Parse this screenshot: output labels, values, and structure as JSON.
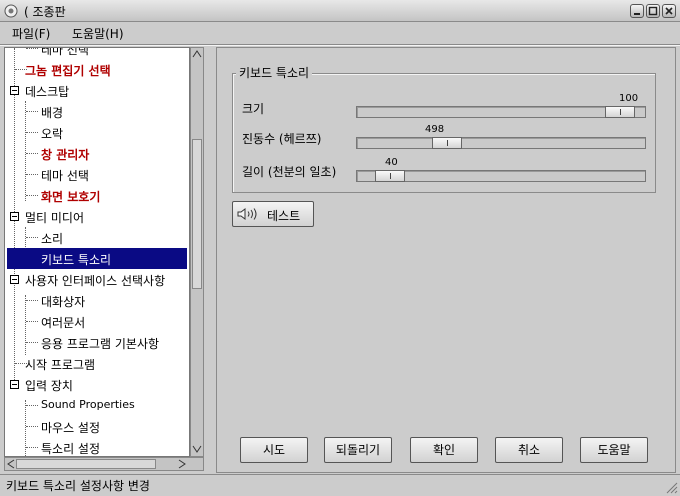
{
  "window": {
    "title": "조종판"
  },
  "menu": {
    "items": [
      {
        "label": "파일(F)"
      },
      {
        "label": "도움말(H)"
      }
    ]
  },
  "tree": {
    "items": [
      {
        "label": "테마 선택",
        "style": "normal"
      },
      {
        "label": "그놈 편집기 선택",
        "style": "red"
      },
      {
        "label": "데스크탑",
        "style": "expander"
      },
      {
        "label": "배경",
        "style": "normal"
      },
      {
        "label": "오락",
        "style": "normal"
      },
      {
        "label": "창 관리자",
        "style": "red"
      },
      {
        "label": "테마 선택",
        "style": "normal"
      },
      {
        "label": "화면 보호기",
        "style": "red"
      },
      {
        "label": "멀티 미디어",
        "style": "expander"
      },
      {
        "label": "소리",
        "style": "normal"
      },
      {
        "label": "키보드 특소리",
        "style": "selected"
      },
      {
        "label": "사용자 인터페이스 선택사항",
        "style": "expander"
      },
      {
        "label": "대화상자",
        "style": "normal"
      },
      {
        "label": "여러문서",
        "style": "normal"
      },
      {
        "label": "응용 프로그램 기본사항",
        "style": "normal"
      },
      {
        "label": "시작 프로그램",
        "style": "normal"
      },
      {
        "label": "입력 장치",
        "style": "expander"
      },
      {
        "label": "Sound Properties",
        "style": "normal"
      },
      {
        "label": "마우스 설정",
        "style": "normal"
      },
      {
        "label": "특소리 설정",
        "style": "normal"
      }
    ]
  },
  "panel": {
    "group_title": "키보드 특소리",
    "sliders": [
      {
        "label": "크기",
        "value": "100",
        "fraction": 0.96
      },
      {
        "label": "진동수 (헤르쯔)",
        "value": "498",
        "fraction": 0.29
      },
      {
        "label": "길이 (천분의 일초)",
        "value": "40",
        "fraction": 0.07
      }
    ],
    "test_button": "테스트"
  },
  "buttons": {
    "try": "시도",
    "revert": "되돌리기",
    "ok": "확인",
    "cancel": "취소",
    "help": "도움말"
  },
  "status": {
    "text": "키보드 특소리 설정사항 변경"
  },
  "icons": {
    "window": "window-menu-icon",
    "speaker": "speaker-icon",
    "minimize": "minimize-icon",
    "maximize": "maximize-icon",
    "close": "close-icon"
  }
}
